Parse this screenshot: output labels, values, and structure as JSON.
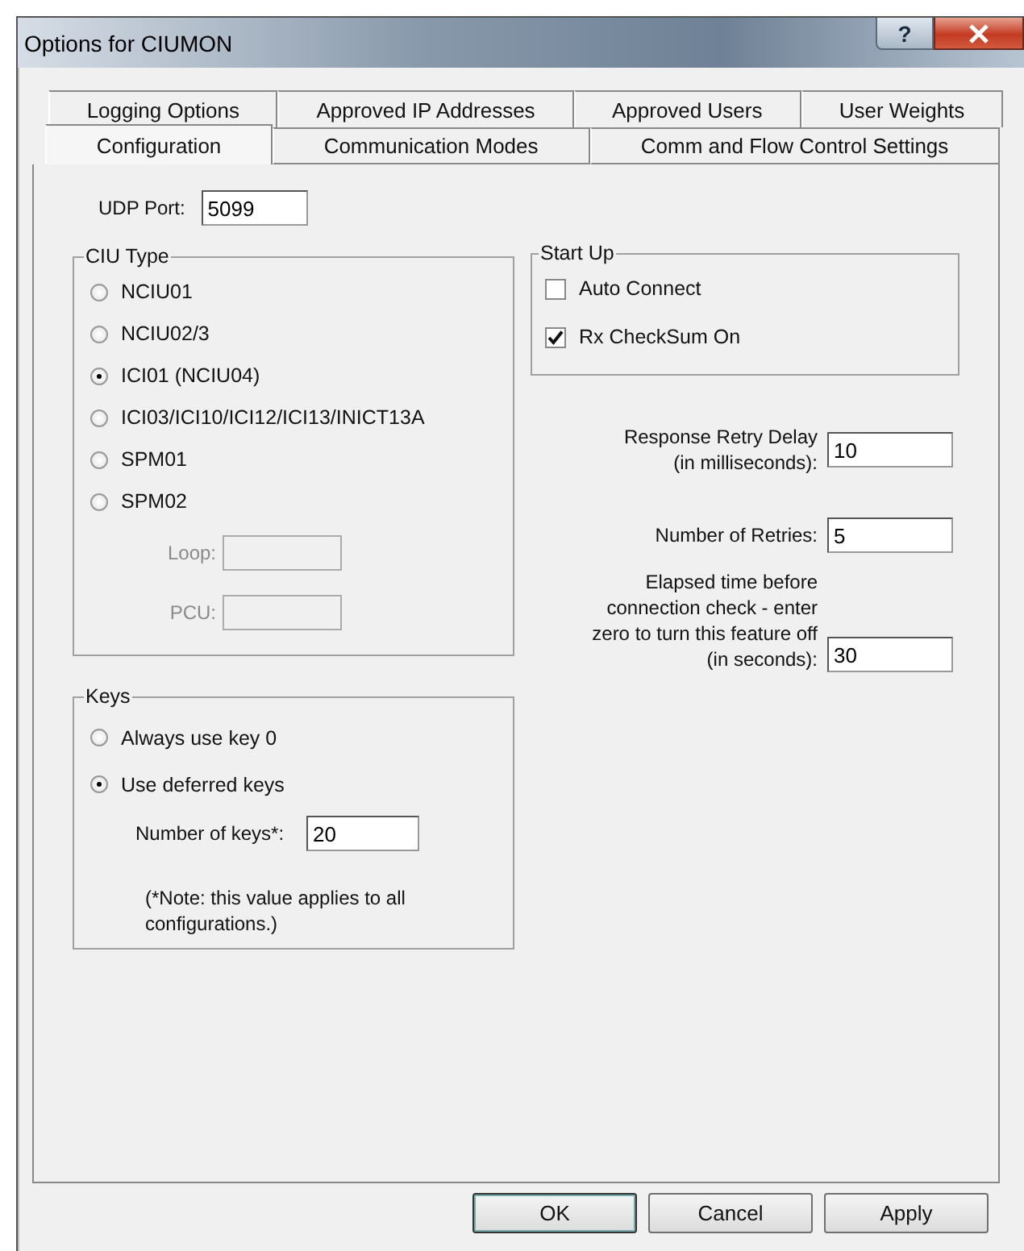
{
  "window": {
    "title": "Options for CIUMON",
    "help_button": "?"
  },
  "tab_rows": [
    {
      "tabs": [
        {
          "label": "Logging Options",
          "selected": false
        },
        {
          "label": "Approved IP Addresses",
          "selected": false
        },
        {
          "label": "Approved Users",
          "selected": false
        },
        {
          "label": "User Weights",
          "selected": false
        }
      ]
    },
    {
      "tabs": [
        {
          "label": "Configuration",
          "selected": true
        },
        {
          "label": "Communication Modes",
          "selected": false
        },
        {
          "label": "Comm and Flow Control Settings",
          "selected": false
        }
      ]
    }
  ],
  "udp_port": {
    "label": "UDP Port:",
    "value": "5099"
  },
  "ciu_type": {
    "title": "CIU Type",
    "options": [
      {
        "label": "NCIU01",
        "selected": false
      },
      {
        "label": "NCIU02/3",
        "selected": false
      },
      {
        "label": "ICI01 (NCIU04)",
        "selected": true
      },
      {
        "label": "ICI03/ICI10/ICI12/ICI13/INICT13A",
        "selected": false
      },
      {
        "label": "SPM01",
        "selected": false
      },
      {
        "label": "SPM02",
        "selected": false
      }
    ],
    "fields": [
      {
        "label": "Loop:",
        "disabled": true
      },
      {
        "label": "PCU:",
        "disabled": true
      }
    ]
  },
  "keys": {
    "title": "Keys",
    "options": [
      {
        "label": "Always use key 0",
        "selected": false
      },
      {
        "label": "Use deferred keys",
        "selected": true
      }
    ],
    "number_of_keys": {
      "label": "Number of keys*:",
      "value": "20"
    },
    "note": "(*Note: this value applies to all configurations.)"
  },
  "start_up": {
    "title": "Start Up",
    "checkboxes": [
      {
        "label": "Auto Connect",
        "checked": false
      },
      {
        "label": "Rx CheckSum On",
        "checked": true
      }
    ]
  },
  "settings": [
    {
      "label_lines": [
        "Response Retry Delay",
        "(in milliseconds):"
      ],
      "value": "10"
    },
    {
      "label_lines": [
        "Number of Retries:"
      ],
      "value": "5"
    },
    {
      "label_lines": [
        "Elapsed time before",
        "connection check - enter",
        "zero to turn this feature off",
        "(in seconds):"
      ],
      "value": "30"
    }
  ],
  "buttons": [
    {
      "label": "OK",
      "default": true
    },
    {
      "label": "Cancel",
      "default": false
    },
    {
      "label": "Apply",
      "default": false
    }
  ]
}
